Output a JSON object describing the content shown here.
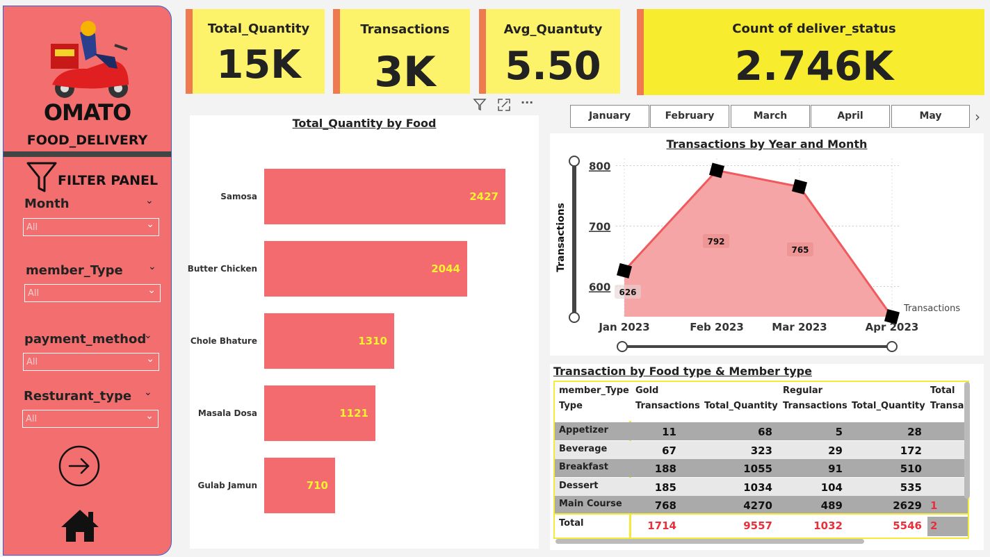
{
  "sidebar": {
    "brand_title": "OMATO",
    "brand_subtitle": "FOOD_DELIVERY",
    "filter_panel_label": "FILTER PANEL",
    "filters": [
      {
        "label": "Month",
        "value": "All"
      },
      {
        "label": "member_Type",
        "value": "All"
      },
      {
        "label": "payment_method",
        "value": "All"
      },
      {
        "label": "Resturant_type",
        "value": "All"
      }
    ]
  },
  "kpis": [
    {
      "title": "Total_Quantity",
      "value": "15K"
    },
    {
      "title": "Transactions",
      "value": "3K"
    },
    {
      "title": "Avg_Quantuty",
      "value": "5.50"
    },
    {
      "title": "Count of deliver_status",
      "value": "2.746K"
    }
  ],
  "months": [
    "January",
    "February",
    "March",
    "April",
    "May"
  ],
  "bar_chart": {
    "chart_data": {
      "type": "bar",
      "title": "Total_Quantity by Food",
      "categories": [
        "Samosa",
        "Butter Chicken",
        "Chole Bhature",
        "Masala Dosa",
        "Gulab Jamun"
      ],
      "values": [
        2427,
        2044,
        1310,
        1121,
        710
      ],
      "labels": [
        "2427",
        "2044",
        "1310",
        "1121",
        "710"
      ],
      "xlim": [
        0,
        2500
      ]
    }
  },
  "area_chart": {
    "chart_data": {
      "type": "area",
      "title": "Transactions by Year and Month",
      "x": [
        "Jan 2023",
        "Feb 2023",
        "Mar 2023",
        "Apr 2023"
      ],
      "values": [
        626,
        792,
        765,
        550
      ],
      "data_labels": [
        "626",
        "792",
        "765",
        ""
      ],
      "ylabel": "Transactions",
      "series_label": "Transactions",
      "yticks": [
        "800",
        "700",
        "600"
      ],
      "ytick_values": [
        800,
        700,
        600
      ],
      "ylim": [
        550,
        812
      ]
    }
  },
  "table": {
    "title": "Transaction by Food type & Member type",
    "header_row1": [
      "member_Type",
      "Gold",
      "",
      "Regular",
      "",
      "Total"
    ],
    "header_row2": [
      "Type",
      "Transactions",
      "Total_Quantity",
      "Transactions",
      "Total_Quantity",
      "Transac"
    ],
    "rows": [
      {
        "type": "Appetizer",
        "cells": [
          "11",
          "68",
          "5",
          "28"
        ]
      },
      {
        "type": "Beverage",
        "cells": [
          "67",
          "323",
          "29",
          "172"
        ]
      },
      {
        "type": "Breakfast",
        "cells": [
          "188",
          "1055",
          "91",
          "510"
        ]
      },
      {
        "type": "Dessert",
        "cells": [
          "185",
          "1034",
          "104",
          "535"
        ]
      },
      {
        "type": "Main Course",
        "cells": [
          "768",
          "4270",
          "489",
          "2629"
        ]
      }
    ],
    "main_course_total_partial": "1",
    "total_row": {
      "type": "Total",
      "cells": [
        "1714",
        "9557",
        "1032",
        "5546"
      ],
      "partial": "2"
    }
  },
  "colors": {
    "accent": "#f36e6e",
    "kpi": "#fcf36b",
    "total_text": "#e8303c",
    "bar_label": "#f9f230"
  }
}
